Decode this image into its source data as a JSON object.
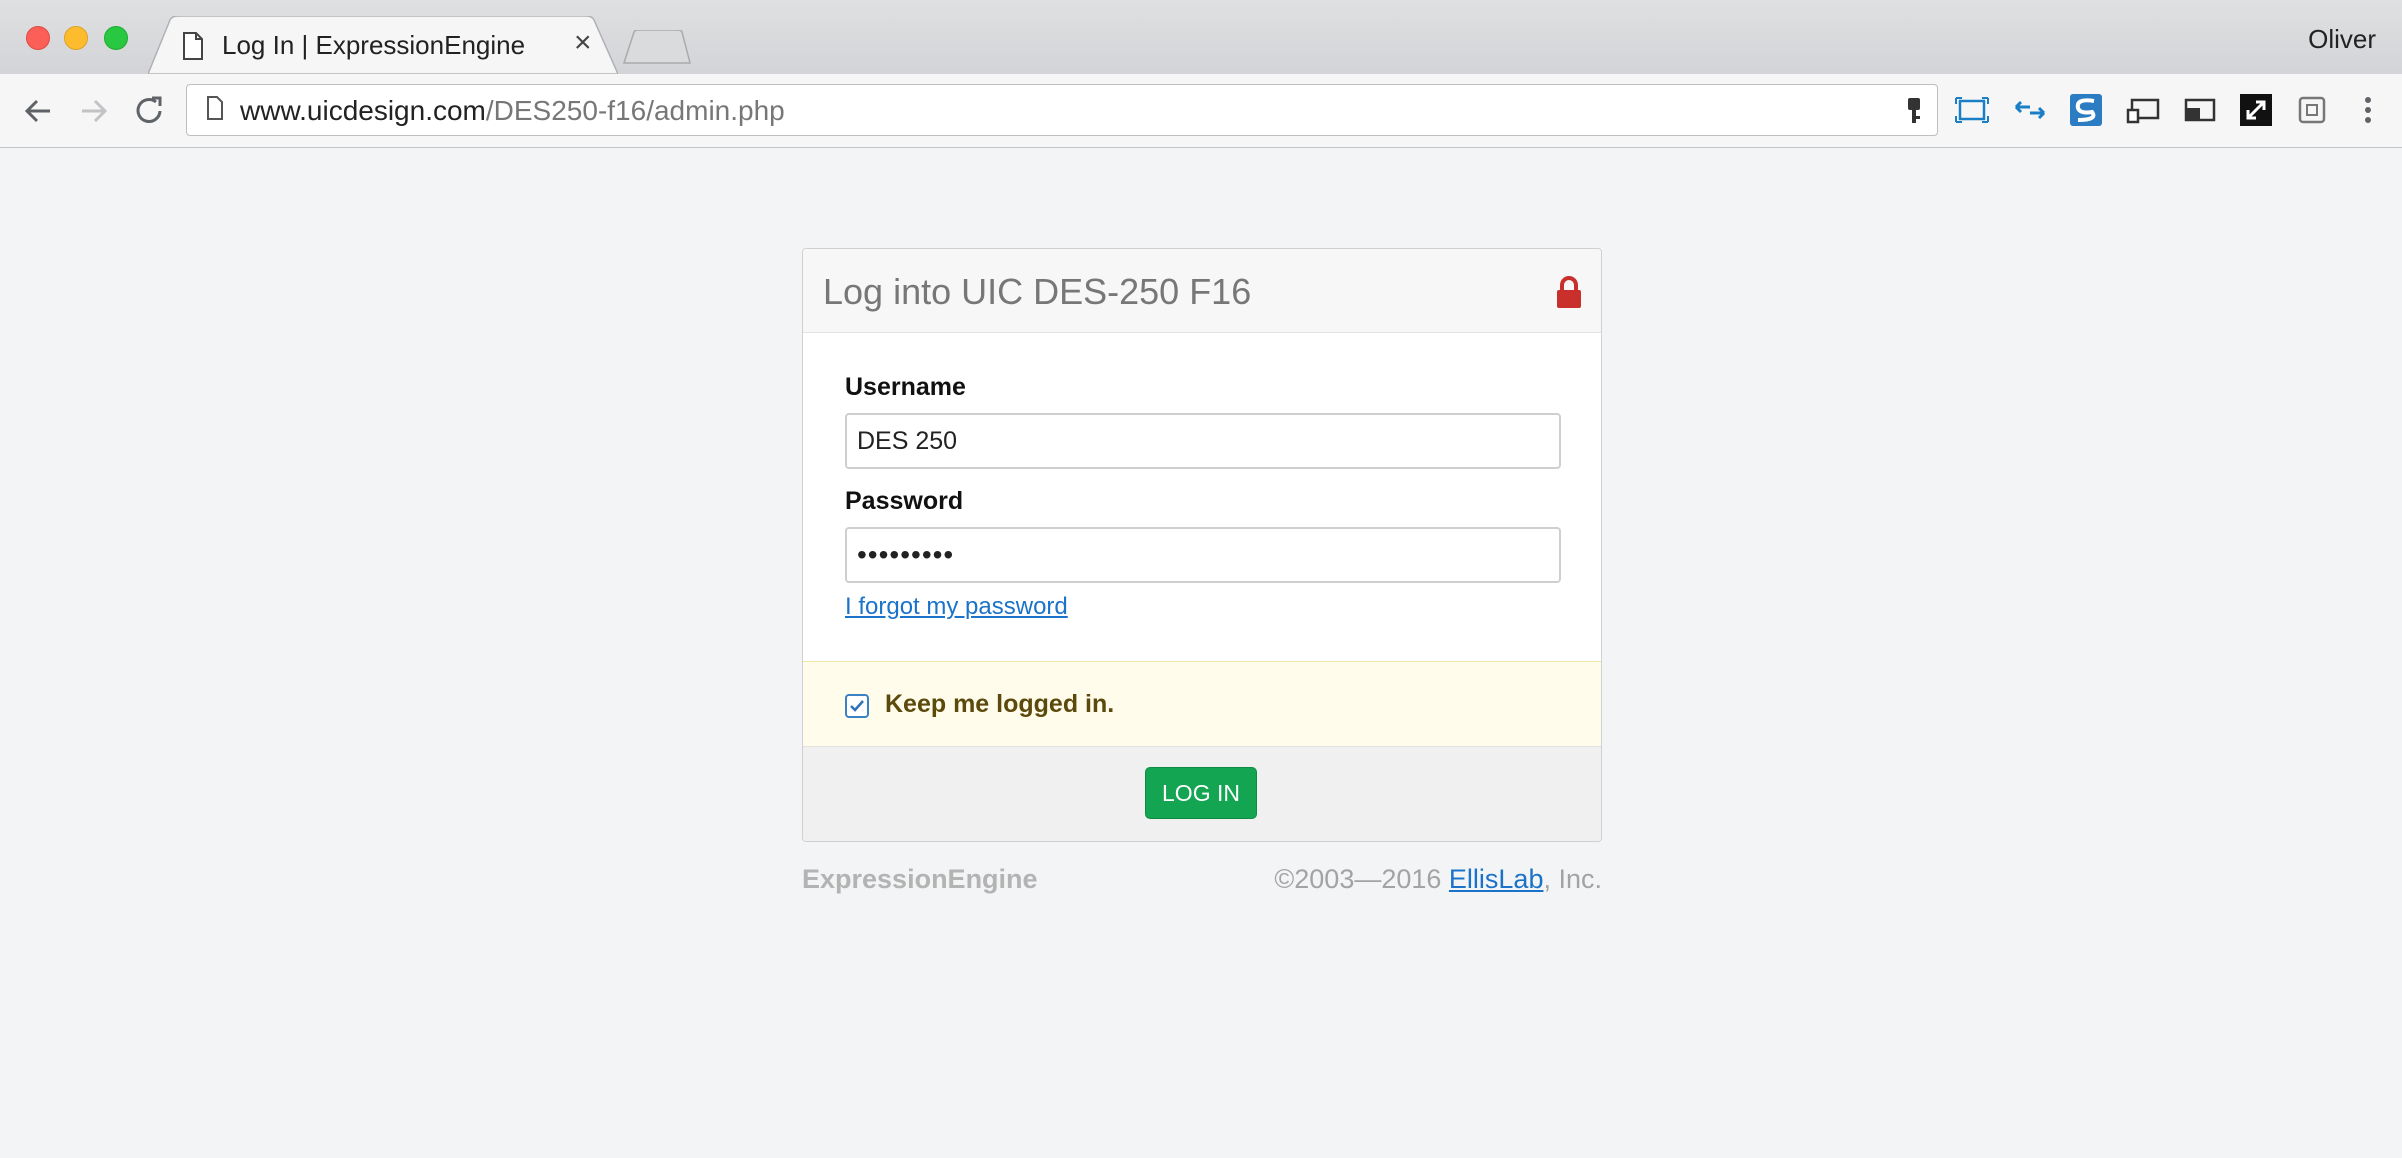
{
  "browser": {
    "tab_title": "Log In | ExpressionEngine",
    "tab_close": "×",
    "profile_name": "Oliver",
    "url_host": "www.uicdesign.com",
    "url_path": "/DES250-f16/admin.php",
    "extensions": [
      "key-icon",
      "screenshot-icon",
      "arrows-icon",
      "s-icon",
      "cast-icon",
      "display-icon",
      "expand-icon",
      "window-icon",
      "menu-icon"
    ]
  },
  "login": {
    "title": "Log into UIC DES-250 F16",
    "username_label": "Username",
    "username_value": "DES 250",
    "password_label": "Password",
    "password_value": "•••••••••",
    "forgot_link": "I forgot my password",
    "remember_label": "Keep me logged in.",
    "remember_checked": true,
    "submit_label": "LOG IN"
  },
  "footer": {
    "brand": "ExpressionEngine",
    "copyright_prefix": "©2003—2016 ",
    "company_link": "EllisLab",
    "copyright_suffix": ", Inc."
  },
  "colors": {
    "accent_green": "#14a552",
    "link_blue": "#1a73c9",
    "lock_red": "#c9302c"
  }
}
